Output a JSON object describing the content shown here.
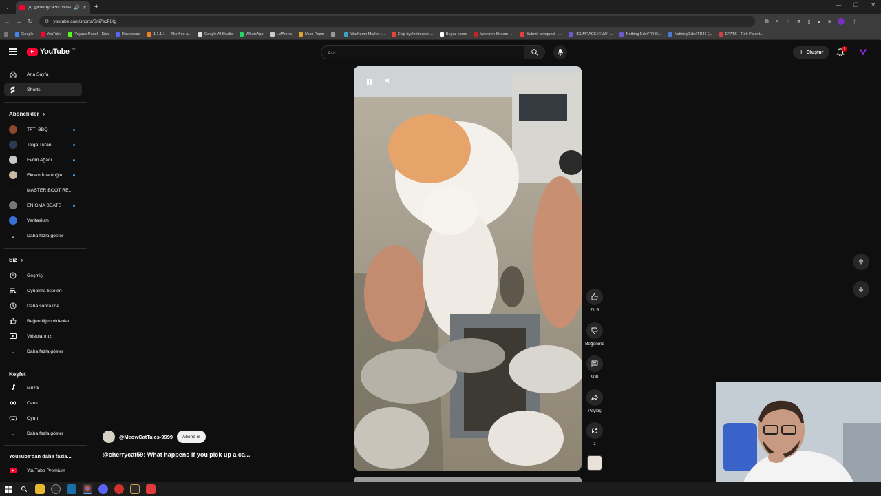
{
  "browser": {
    "tab_title": "(8) @cherrycat59: What hap...",
    "url": "youtube.com/shorts/Brli7scPiXg",
    "bookmarks": [
      {
        "label": "Google",
        "color": "#4285f4"
      },
      {
        "label": "YouTube",
        "color": "#ff0033"
      },
      {
        "label": "Yayıncı Paneli | Kick",
        "color": "#53fc18"
      },
      {
        "label": "Dashboard",
        "color": "#5865f2"
      },
      {
        "label": "1.1.1.1 — The free a...",
        "color": "#f38020"
      },
      {
        "label": "Google AI Studio",
        "color": "#dddddd"
      },
      {
        "label": "WhatsApp",
        "color": "#25d366"
      },
      {
        "label": "LMArena",
        "color": "#cccccc"
      },
      {
        "label": "Usko Pazar",
        "color": "#e0a030"
      },
      {
        "label": "",
        "color": "#999999"
      },
      {
        "label": "Warframe Market |...",
        "color": "#3aa0c8"
      },
      {
        "label": "Ekip üyelerimizden...",
        "color": "#ea4335"
      },
      {
        "label": "Beyaz ekran",
        "color": "#ffffff"
      },
      {
        "label": "Vechiron Stream -...",
        "color": "#cc2222"
      },
      {
        "label": "Submit a request –...",
        "color": "#e04040"
      },
      {
        "label": "HEUMRAGE#EUW -...",
        "color": "#6a5acd"
      },
      {
        "label": "Nothing Ede#TR46...",
        "color": "#6a5acd"
      },
      {
        "label": "Nothing Ede#TR46 (...",
        "color": "#4a7bd0"
      },
      {
        "label": "EPATS - Türk Patent...",
        "color": "#d04040"
      }
    ]
  },
  "header": {
    "logo_text": "YouTube",
    "logo_region": "TR",
    "search_placeholder": "Ara",
    "create_label": "Oluştur",
    "notification_count": "9"
  },
  "sidebar": {
    "main": [
      {
        "label": "Ana Sayfa",
        "icon": "home-icon"
      },
      {
        "label": "Shorts",
        "icon": "shorts-icon",
        "active": true
      }
    ],
    "subscriptions_title": "Abonelikler",
    "subscriptions": [
      {
        "label": "TFTI BBQ",
        "color": "#8b4a2e",
        "new": true
      },
      {
        "label": "Tolga Turan",
        "color": "#2b3a55",
        "new": true
      },
      {
        "label": "Evrim Ağacı",
        "color": "#c8c8c8",
        "new": true
      },
      {
        "label": "Ekrem İmamoğlu",
        "color": "#c9b8a0",
        "new": true
      },
      {
        "label": "MASTER BOOT RE...",
        "color": "#111111",
        "new": false
      },
      {
        "label": "ENIGMA BEATS",
        "color": "#777777",
        "new": true
      },
      {
        "label": "Veritasium",
        "color": "#3b6fd6",
        "new": false
      }
    ],
    "subs_more": "Daha fazla göster",
    "you_title": "Siz",
    "you": [
      {
        "label": "Geçmiş",
        "icon": "history-icon"
      },
      {
        "label": "Oynatma listeleri",
        "icon": "playlist-icon"
      },
      {
        "label": "Daha sonra izle",
        "icon": "clock-icon"
      },
      {
        "label": "Beğendiğim videolar",
        "icon": "thumbs-up-icon"
      },
      {
        "label": "Videolarınız",
        "icon": "video-icon"
      }
    ],
    "you_more": "Daha fazla göster",
    "explore_title": "Keşfet",
    "explore": [
      {
        "label": "Müzik",
        "icon": "music-icon"
      },
      {
        "label": "Canlı",
        "icon": "live-icon"
      },
      {
        "label": "Oyun",
        "icon": "gaming-icon"
      }
    ],
    "explore_more": "Daha fazla göster",
    "more_title": "YouTube'dan daha fazla...",
    "premium_label": "YouTube Premium"
  },
  "short": {
    "channel": "@MeowCatTales-9999",
    "subscribe_label": "Abone ol",
    "title": "@cherrycat59: What happens if you pick up a ca...",
    "actions": [
      {
        "name": "like-button",
        "icon": "thumbs-up-icon",
        "label": "71 B"
      },
      {
        "name": "dislike-button",
        "icon": "thumbs-down-icon",
        "label": "Beğenme"
      },
      {
        "name": "comments-button",
        "icon": "comment-icon",
        "label": "900"
      },
      {
        "name": "share-button",
        "icon": "share-icon",
        "label": "Paylaş"
      },
      {
        "name": "remix-button",
        "icon": "remix-icon",
        "label": "1"
      }
    ]
  },
  "colors": {
    "background": "#0f0f0f",
    "brand_red": "#ff0033",
    "active_item": "#272727",
    "accent_blue": "#3ea6ff"
  }
}
